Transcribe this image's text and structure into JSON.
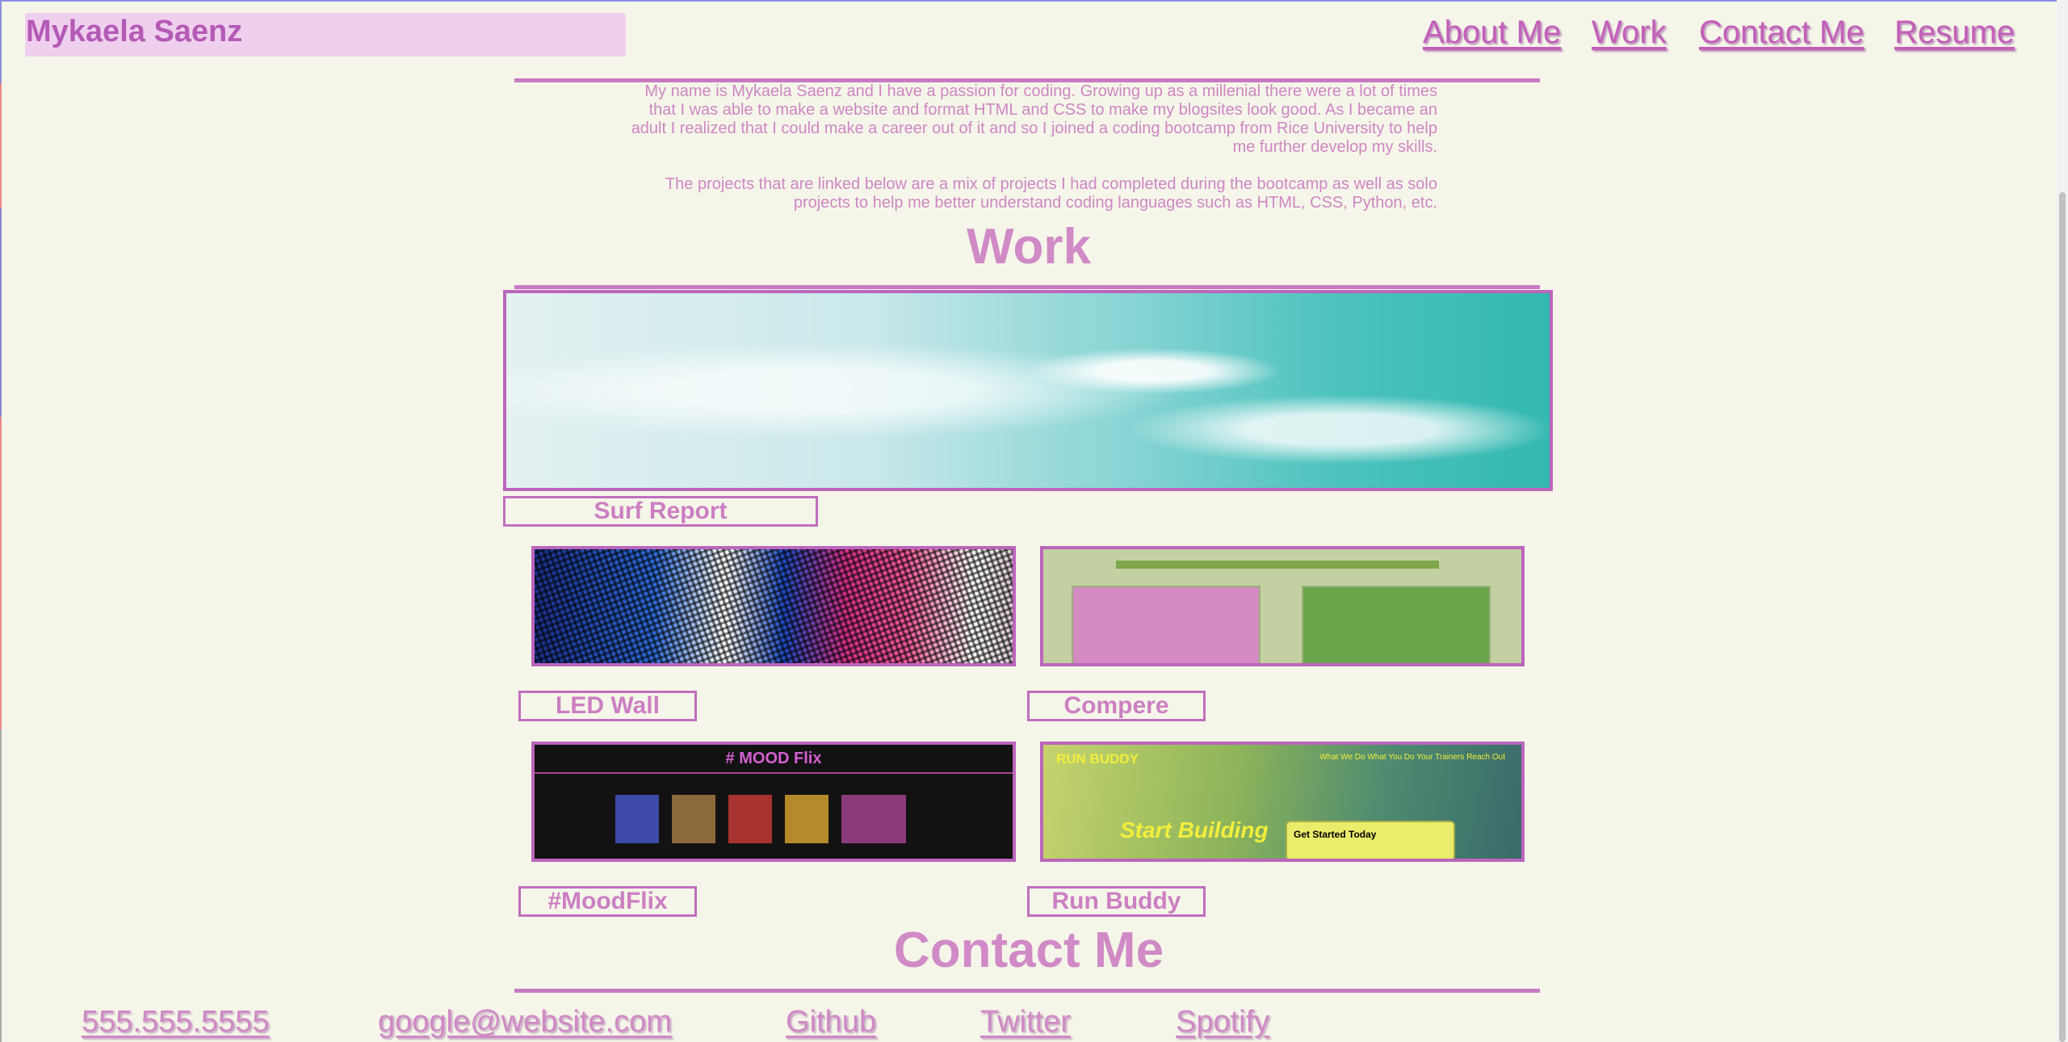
{
  "header": {
    "brand": "Mykaela Saenz",
    "nav": [
      "About Me",
      "Work",
      "Contact Me",
      "Resume"
    ]
  },
  "about": {
    "paragraphs": [
      "My name is Mykaela Saenz and I have a passion for coding. Growing up as a millenial there were a lot of times that I was able to make a website and format HTML and CSS to make my blogsites look good. As I became an adult I realized that I could make a career out of it and so I joined a coding bootcamp from Rice University to help me further develop my skills.",
      "The projects that are linked below are a mix of projects I had completed during the bootcamp as well as solo projects to help me better understand coding languages such as HTML, CSS, Python, etc."
    ]
  },
  "work": {
    "title": "Work",
    "projects": [
      {
        "label": "Surf Report"
      },
      {
        "label": "LED Wall"
      },
      {
        "label": "Compere"
      },
      {
        "label": "#MoodFlix"
      },
      {
        "label": "Run Buddy"
      }
    ],
    "thumbnails": {
      "moodflix_title": "# MOOD Flix",
      "runbuddy_title": "RUN BUDDY",
      "runbuddy_nav": "What We Do    What You Do    Your Trainers    Reach Out",
      "runbuddy_hero": "Start Building",
      "runbuddy_card": "Get Started Today"
    }
  },
  "contact": {
    "title": "Contact Me",
    "links": [
      "555.555.5555",
      "google@website.com",
      "Github",
      "Twitter",
      "Spotify"
    ]
  }
}
